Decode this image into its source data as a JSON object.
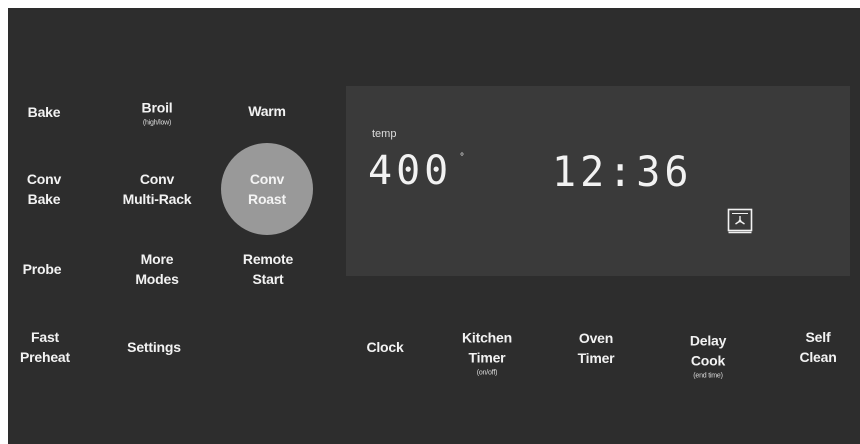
{
  "colors": {
    "panel_background": "#2d2d2d",
    "display_background": "#3a3a3a",
    "selected_key": "#999999",
    "text": "#f2f2f2"
  },
  "keys": {
    "bake": {
      "label": "Bake"
    },
    "broil": {
      "label": "Broil",
      "sub": "(high/low)"
    },
    "warm": {
      "label": "Warm"
    },
    "conv_bake": {
      "line1": "Conv",
      "line2": "Bake"
    },
    "conv_multirack": {
      "line1": "Conv",
      "line2": "Multi-Rack"
    },
    "conv_roast": {
      "line1": "Conv",
      "line2": "Roast",
      "selected": true
    },
    "probe": {
      "label": "Probe"
    },
    "more_modes": {
      "line1": "More",
      "line2": "Modes"
    },
    "remote_start": {
      "line1": "Remote",
      "line2": "Start"
    },
    "fast_preheat": {
      "line1": "Fast",
      "line2": "Preheat"
    },
    "settings": {
      "label": "Settings"
    },
    "clock": {
      "label": "Clock"
    },
    "kitchen_timer": {
      "line1": "Kitchen",
      "line2": "Timer",
      "sub": "(on/off)"
    },
    "oven_timer": {
      "line1": "Oven",
      "line2": "Timer"
    },
    "delay_cook": {
      "line1": "Delay",
      "line2": "Cook",
      "sub": "(end time)"
    },
    "self_clean": {
      "line1": "Self",
      "line2": "Clean"
    }
  },
  "display": {
    "label": "temp",
    "temperature": "400",
    "degree_symbol": "°",
    "time": "12:36",
    "icon": "convection-fan-icon"
  }
}
